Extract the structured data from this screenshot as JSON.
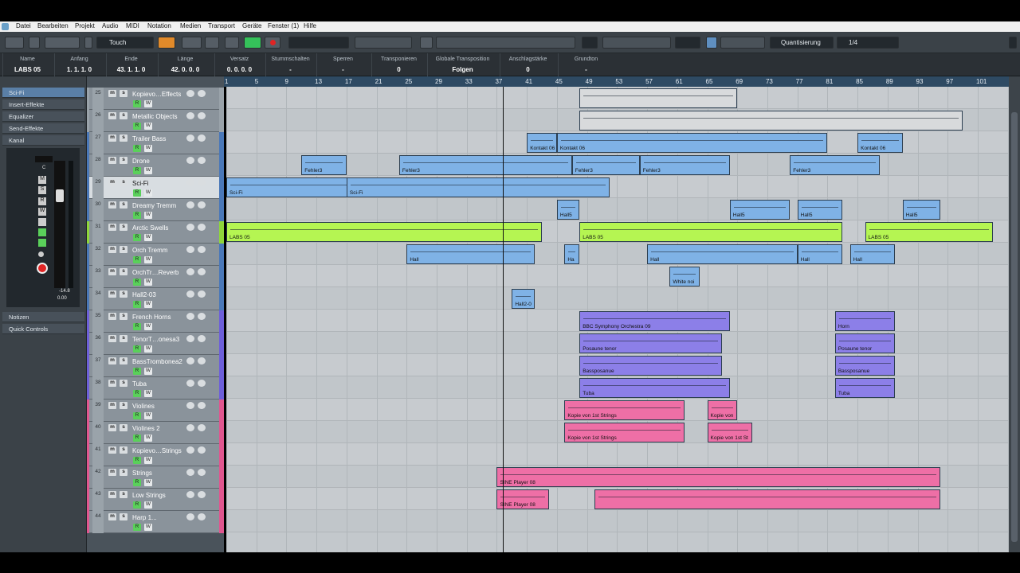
{
  "menu": [
    "Datei",
    "Bearbeiten",
    "Projekt",
    "Audio",
    "MIDI",
    "Notation",
    "Medien",
    "Transport",
    "Geräte",
    "Fenster (1)",
    "Hilfe"
  ],
  "toolbar": {
    "automation_mode": "Touch",
    "snap_label": "Quantisierung",
    "quantize_value": "1/4"
  },
  "infoline": [
    {
      "h": "Name",
      "v": "LABS 05"
    },
    {
      "h": "Anfang",
      "v": "1. 1. 1. 0"
    },
    {
      "h": "Ende",
      "v": "43. 1. 1. 0"
    },
    {
      "h": "Länge",
      "v": "42. 0. 0. 0"
    },
    {
      "h": "Versatz",
      "v": "0. 0. 0. 0"
    },
    {
      "h": "Stummschalten",
      "v": "-"
    },
    {
      "h": "Sperren",
      "v": "-"
    },
    {
      "h": "Transponieren",
      "v": "0"
    },
    {
      "h": "Globale Transposition",
      "v": "Folgen"
    },
    {
      "h": "Anschlagstärke",
      "v": "0"
    },
    {
      "h": "Grundton",
      "v": "-"
    }
  ],
  "inspector": {
    "title": "Sci-Fi",
    "sections": [
      "Insert-Effekte",
      "Equalizer",
      "Send-Effekte",
      "Kanal"
    ],
    "bottom_sections": [
      "Notizen",
      "Quick Controls"
    ],
    "fader_db": "-14.8",
    "pan_value": "0.00",
    "pan_letter": "C"
  },
  "ruler": [
    "1",
    "5",
    "9",
    "13",
    "17",
    "21",
    "25",
    "29",
    "33",
    "37",
    "41",
    "45",
    "49",
    "53",
    "57",
    "61",
    "65",
    "69",
    "73",
    "77",
    "81",
    "85",
    "89",
    "93",
    "97",
    "101"
  ],
  "tracks": [
    {
      "num": "25",
      "name": "Kopievo…Effects",
      "color": "#9aa3aa"
    },
    {
      "num": "26",
      "name": "Metallic Objects",
      "color": "#9aa3aa"
    },
    {
      "num": "27",
      "name": "Trailer Bass",
      "color": "#4a78b8"
    },
    {
      "num": "28",
      "name": "Drone",
      "color": "#4a78b8"
    },
    {
      "num": "29",
      "name": "Sci-Fi",
      "color": "#4a78b8",
      "selected": true
    },
    {
      "num": "30",
      "name": "Dreamy Tremm",
      "color": "#4a78b8"
    },
    {
      "num": "31",
      "name": "Arctic Swells",
      "color": "#8fd63a"
    },
    {
      "num": "32",
      "name": "Orch Tremm",
      "color": "#4a78b8"
    },
    {
      "num": "33",
      "name": "OrchTr…Reverb",
      "color": "#4a78b8"
    },
    {
      "num": "34",
      "name": "Hall2-03",
      "color": "#4a78b8"
    },
    {
      "num": "35",
      "name": "French Horns",
      "color": "#6d5fd9"
    },
    {
      "num": "36",
      "name": "TenorT…onesa3",
      "color": "#6d5fd9"
    },
    {
      "num": "37",
      "name": "BassTrombonea2",
      "color": "#6d5fd9"
    },
    {
      "num": "38",
      "name": "Tuba",
      "color": "#6d5fd9"
    },
    {
      "num": "39",
      "name": "Violines",
      "color": "#e0568f"
    },
    {
      "num": "40",
      "name": "Violines 2",
      "color": "#e0568f"
    },
    {
      "num": "41",
      "name": "Kopievo…Strings",
      "color": "#e0568f"
    },
    {
      "num": "42",
      "name": "Strings",
      "color": "#e0568f"
    },
    {
      "num": "43",
      "name": "Low Strings",
      "color": "#e0568f"
    },
    {
      "num": "44",
      "name": "Harp 1...",
      "color": "#e0568f"
    }
  ],
  "events": [
    {
      "label": "Kontakt 06",
      "cls": "blue",
      "bar": 41,
      "len": 4,
      "lane": 2
    },
    {
      "label": "Kontakt 06",
      "cls": "blue",
      "bar": 45,
      "len": 36,
      "lane": 2
    },
    {
      "label": "Kontakt 06",
      "cls": "blue",
      "bar": 85,
      "len": 6,
      "lane": 2
    },
    {
      "label": "Fehler3",
      "cls": "blue",
      "bar": 11,
      "len": 6,
      "lane": 3
    },
    {
      "label": "Fehler3",
      "cls": "blue",
      "bar": 24,
      "len": 23,
      "lane": 3
    },
    {
      "label": "Fehler3",
      "cls": "blue",
      "bar": 47,
      "len": 9,
      "lane": 3
    },
    {
      "label": "Fehler3",
      "cls": "blue",
      "bar": 56,
      "len": 12,
      "lane": 3
    },
    {
      "label": "Fehler3",
      "cls": "blue",
      "bar": 76,
      "len": 12,
      "lane": 3
    },
    {
      "label": "Sci-Fi",
      "cls": "blue",
      "bar": 1,
      "len": 17,
      "lane": 4
    },
    {
      "label": "Sci-Fi",
      "cls": "blue",
      "bar": 17,
      "len": 35,
      "lane": 4
    },
    {
      "label": "Hall5",
      "cls": "blue",
      "bar": 45,
      "len": 3,
      "lane": 5
    },
    {
      "label": "Hall5",
      "cls": "blue",
      "bar": 68,
      "len": 8,
      "lane": 5
    },
    {
      "label": "Hall5",
      "cls": "blue",
      "bar": 77,
      "len": 6,
      "lane": 5
    },
    {
      "label": "Hall5",
      "cls": "blue",
      "bar": 91,
      "len": 5,
      "lane": 5
    },
    {
      "label": "LABS 05",
      "cls": "green",
      "bar": 1,
      "len": 42,
      "lane": 6
    },
    {
      "label": "LABS 05",
      "cls": "green",
      "bar": 48,
      "len": 35,
      "lane": 6
    },
    {
      "label": "LABS 05",
      "cls": "green",
      "bar": 86,
      "len": 17,
      "lane": 6
    },
    {
      "label": "Hall",
      "cls": "blue",
      "bar": 25,
      "len": 17,
      "lane": 7
    },
    {
      "label": "Ha",
      "cls": "blue",
      "bar": 46,
      "len": 2,
      "lane": 7
    },
    {
      "label": "Hall",
      "cls": "blue",
      "bar": 57,
      "len": 20,
      "lane": 7
    },
    {
      "label": "Hall",
      "cls": "blue",
      "bar": 77,
      "len": 6,
      "lane": 7
    },
    {
      "label": "Hall",
      "cls": "blue",
      "bar": 84,
      "len": 6,
      "lane": 7
    },
    {
      "label": "White noi",
      "cls": "blue",
      "bar": 60,
      "len": 4,
      "lane": 8
    },
    {
      "label": "Hall2-0",
      "cls": "blue",
      "bar": 39,
      "len": 3,
      "lane": 9
    },
    {
      "label": "BBC Symphony Orchestra 09",
      "cls": "purple",
      "bar": 48,
      "len": 20,
      "lane": 10
    },
    {
      "label": "Horn",
      "cls": "purple",
      "bar": 82,
      "len": 8,
      "lane": 10
    },
    {
      "label": "Posaune tenor",
      "cls": "purple",
      "bar": 48,
      "len": 19,
      "lane": 11
    },
    {
      "label": "Posaune tenor",
      "cls": "purple",
      "bar": 82,
      "len": 8,
      "lane": 11
    },
    {
      "label": "Bassposanue",
      "cls": "purple",
      "bar": 48,
      "len": 19,
      "lane": 12
    },
    {
      "label": "Bassposanue",
      "cls": "purple",
      "bar": 82,
      "len": 8,
      "lane": 12
    },
    {
      "label": "Tuba",
      "cls": "purple",
      "bar": 48,
      "len": 20,
      "lane": 13
    },
    {
      "label": "Tuba",
      "cls": "purple",
      "bar": 82,
      "len": 8,
      "lane": 13
    },
    {
      "label": "Kopie von 1st Strings",
      "cls": "pink",
      "bar": 46,
      "len": 16,
      "lane": 14
    },
    {
      "label": "Kopie von",
      "cls": "pink",
      "bar": 65,
      "len": 4,
      "lane": 14
    },
    {
      "label": "Kopie von 1st Strings",
      "cls": "pink",
      "bar": 46,
      "len": 16,
      "lane": 15
    },
    {
      "label": "Kopie von 1st St",
      "cls": "pink",
      "bar": 65,
      "len": 6,
      "lane": 15
    },
    {
      "label": "SINE Player 08",
      "cls": "pink",
      "bar": 37,
      "len": 59,
      "lane": 17
    },
    {
      "label": "SINE Player 08",
      "cls": "pink",
      "bar": 37,
      "len": 7,
      "lane": 18
    },
    {
      "label": "",
      "cls": "pink",
      "bar": 50,
      "len": 46,
      "lane": 18
    },
    {
      "label": "",
      "cls": "grey",
      "bar": 48,
      "len": 21,
      "lane": 0
    },
    {
      "label": "",
      "cls": "grey",
      "bar": 48,
      "len": 51,
      "lane": 1
    }
  ]
}
